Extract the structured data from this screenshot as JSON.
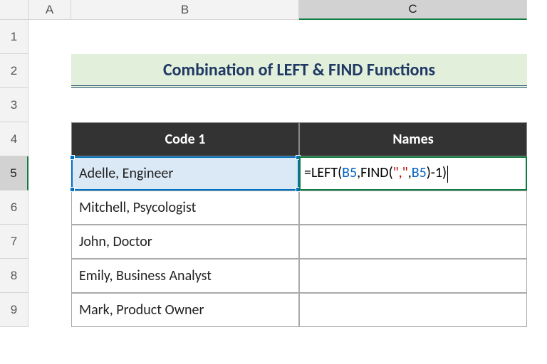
{
  "columns": [
    "A",
    "B",
    "C"
  ],
  "rows": [
    "1",
    "2",
    "3",
    "4",
    "5",
    "6",
    "7",
    "8",
    "9"
  ],
  "active_col_index": 2,
  "active_row_index": 4,
  "title": "Combination of LEFT & FIND Functions",
  "headers": {
    "code1": "Code 1",
    "names": "Names"
  },
  "data_rows": [
    "Adelle, Engineer",
    "Mitchell, Psycologist",
    "John, Doctor",
    "Emily, Business Analyst",
    "Mark, Product Owner"
  ],
  "formula_tokens": [
    {
      "t": "=LEFT(",
      "c": "black"
    },
    {
      "t": "B5",
      "c": "blue"
    },
    {
      "t": ",FIND(",
      "c": "black"
    },
    {
      "t": "\",\"",
      "c": "red"
    },
    {
      "t": ",",
      "c": "black"
    },
    {
      "t": "B5",
      "c": "blue"
    },
    {
      "t": ")",
      "c": "black"
    },
    {
      "t": "-1",
      "c": "black"
    },
    {
      "t": ")",
      "c": "black"
    }
  ],
  "formula_plain": "=LEFT(B5,FIND(\",\",B5)-1)",
  "chart_data": {
    "type": "table",
    "title": "Combination of LEFT & FIND Functions",
    "columns": [
      "Code 1",
      "Names"
    ],
    "rows": [
      [
        "Adelle, Engineer",
        "=LEFT(B5,FIND(\",\",B5)-1)"
      ],
      [
        "Mitchell, Psycologist",
        ""
      ],
      [
        "John, Doctor",
        ""
      ],
      [
        "Emily, Business Analyst",
        ""
      ],
      [
        "Mark, Product Owner",
        ""
      ]
    ]
  }
}
